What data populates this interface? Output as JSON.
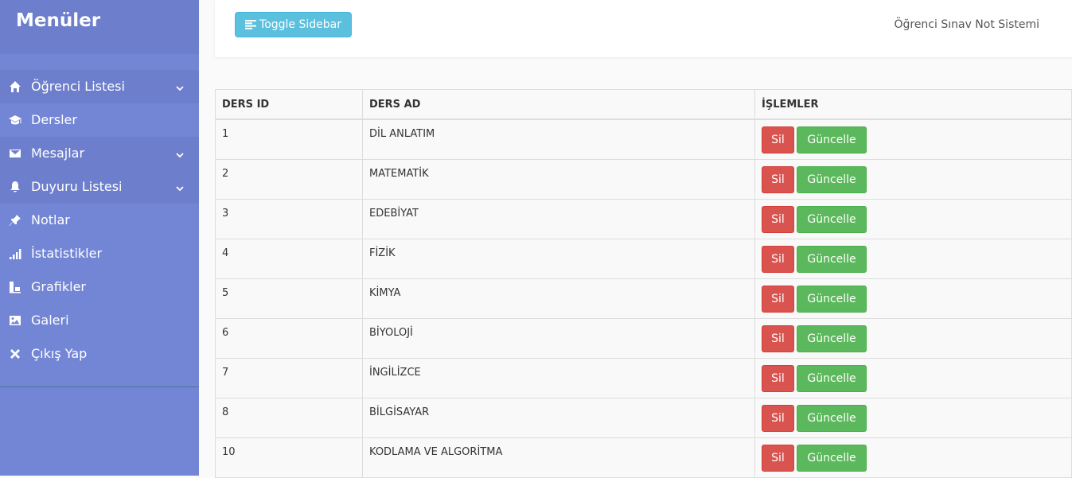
{
  "sidebar": {
    "title": "Menüler",
    "items": [
      {
        "label": "Öğrenci Listesi",
        "icon": "home-icon",
        "dropdown": true
      },
      {
        "label": "Dersler",
        "icon": "graduation-cap-icon",
        "dropdown": false
      },
      {
        "label": "Mesajlar",
        "icon": "envelope-icon",
        "dropdown": true
      },
      {
        "label": "Duyuru Listesi",
        "icon": "bell-icon",
        "dropdown": true
      },
      {
        "label": "Notlar",
        "icon": "pushpin-icon",
        "dropdown": false
      },
      {
        "label": "İstatistikler",
        "icon": "signal-icon",
        "dropdown": false
      },
      {
        "label": "Grafikler",
        "icon": "chart-icon",
        "dropdown": false
      },
      {
        "label": "Galeri",
        "icon": "picture-icon",
        "dropdown": false
      },
      {
        "label": "Çıkış Yap",
        "icon": "close-icon",
        "dropdown": false
      }
    ]
  },
  "navbar": {
    "toggle_label": "Toggle Sidebar",
    "brand": "Öğrenci Sınav Not Sistemi"
  },
  "table": {
    "headers": [
      "DERS ID",
      "DERS AD",
      "İŞLEMLER"
    ],
    "delete_label": "Sil",
    "update_label": "Güncelle",
    "rows": [
      {
        "id": "1",
        "name": "DİL ANLATIM"
      },
      {
        "id": "2",
        "name": "MATEMATİK"
      },
      {
        "id": "3",
        "name": "EDEBİYAT"
      },
      {
        "id": "4",
        "name": "FİZİK"
      },
      {
        "id": "5",
        "name": "KİMYA"
      },
      {
        "id": "6",
        "name": "BİYOLOJİ"
      },
      {
        "id": "7",
        "name": "İNGİLİZCE"
      },
      {
        "id": "8",
        "name": "BİLGİSAYAR"
      },
      {
        "id": "10",
        "name": "KODLAMA VE ALGORİTMA"
      }
    ]
  },
  "colors": {
    "sidebar_bg": "#7386d5",
    "sidebar_dark": "#6d7fcc",
    "toggle_button": "#5bc0de",
    "delete_button": "#d9534f",
    "update_button": "#5cb85c"
  }
}
